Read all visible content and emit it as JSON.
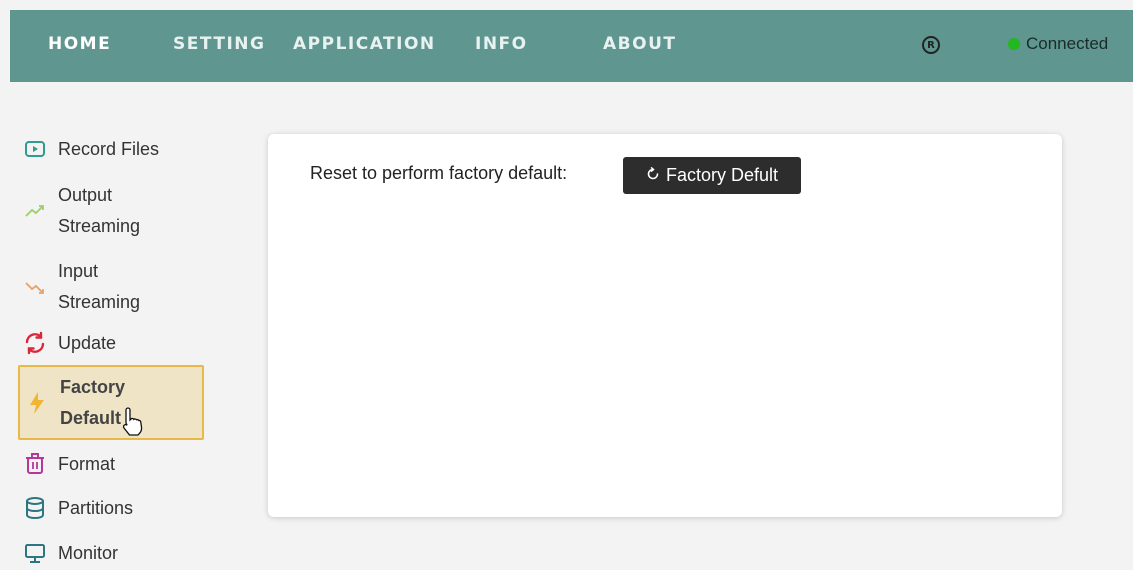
{
  "nav": {
    "home": "HOME",
    "setting": "SETTING",
    "application": "APPLICATION",
    "info": "INFO",
    "about": "ABOUT",
    "status_text": "Connected",
    "status_color": "#22b81f",
    "bar_color": "#5f9690"
  },
  "sidebar": {
    "items": [
      {
        "icon": "play-file-icon",
        "label": "Record Files"
      },
      {
        "icon": "trend-up-icon",
        "label": "Output Streaming"
      },
      {
        "icon": "trend-down-icon",
        "label": "Input Streaming"
      },
      {
        "icon": "refresh-icon",
        "label": "Update"
      },
      {
        "icon": "lightning-icon",
        "label": "Factory Default",
        "active": true
      },
      {
        "icon": "trash-icon",
        "label": "Format"
      },
      {
        "icon": "database-icon",
        "label": "Partitions"
      },
      {
        "icon": "monitor-icon",
        "label": "Monitor"
      }
    ]
  },
  "main": {
    "reset_label": "Reset to perform factory default:",
    "button_label": "Factory Defult"
  }
}
